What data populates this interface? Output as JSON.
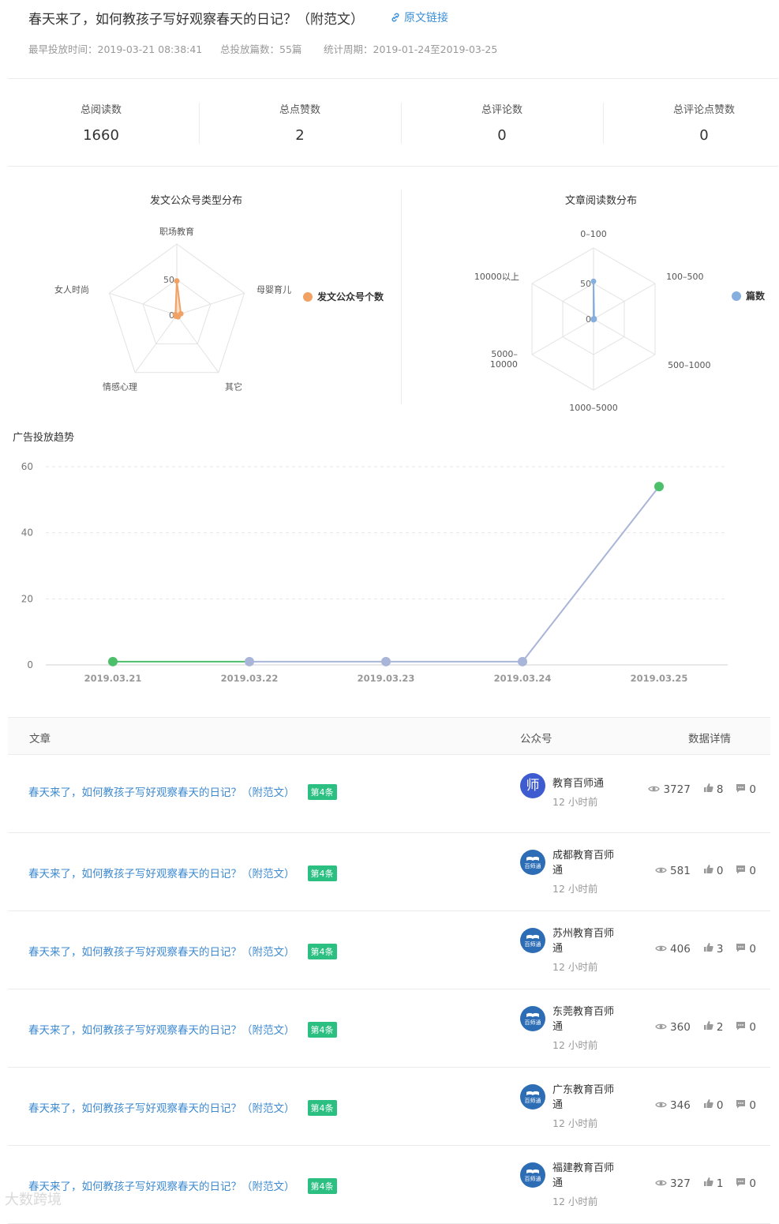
{
  "header": {
    "title": "春天来了，如何教孩子写好观察春天的日记？（附范文）",
    "link_label": "原文链接",
    "meta": [
      "最早投放时间：2019-03-21 08:38:41",
      "总投放篇数：55篇",
      "统计周期：2019-01-24至2019-03-25"
    ]
  },
  "stats": [
    {
      "label": "总阅读数",
      "value": "1660"
    },
    {
      "label": "总点赞数",
      "value": "2"
    },
    {
      "label": "总评论数",
      "value": "0"
    },
    {
      "label": "总评论点赞数",
      "value": "0"
    }
  ],
  "radar1": {
    "title": "发文公众号类型分布",
    "axes": [
      "职场教育",
      "母婴育儿",
      "其它",
      "情感心理",
      "女人时尚"
    ],
    "ticks": [
      "50",
      "0"
    ],
    "series_name": "发文公众号个数",
    "values": [
      48,
      6,
      3,
      2,
      2
    ],
    "max": 100,
    "color": "#f0a264"
  },
  "radar2": {
    "title": "文章阅读数分布",
    "axes": [
      "0–100",
      "100–500",
      "500–1000",
      "1000–5000",
      "5000–\n10000",
      "10000以上"
    ],
    "ticks": [
      "50",
      "0"
    ],
    "series_name": "篇数",
    "values": [
      53,
      1,
      1,
      1,
      0,
      0
    ],
    "max": 100,
    "color": "#86aede"
  },
  "chart_data": {
    "type": "line",
    "title": "广告投放趋势",
    "x": [
      "2019.03.21",
      "2019.03.22",
      "2019.03.23",
      "2019.03.24",
      "2019.03.25"
    ],
    "values": [
      1,
      1,
      1,
      1,
      54
    ],
    "ylim": [
      0,
      60
    ],
    "yticks": [
      "0",
      "20",
      "40",
      "60"
    ],
    "line_color": "#a8b5d9",
    "highlight_color": "#4cbf6b",
    "grid": true
  },
  "table": {
    "headers": [
      "文章",
      "公众号",
      "数据详情"
    ],
    "rows": [
      {
        "article": "春天来了，如何教孩子写好观察春天的日记？（附范文）",
        "badge": "第4条",
        "account": "教育百师通",
        "time": "12 小时前",
        "views": "3727",
        "likes": "8",
        "comments": "0",
        "avatar": "师"
      },
      {
        "article": "春天来了，如何教孩子写好观察春天的日记？（附范文）",
        "badge": "第4条",
        "account": "成都教育百师通",
        "time": "12 小时前",
        "views": "581",
        "likes": "0",
        "comments": "0",
        "avatar": "百师通"
      },
      {
        "article": "春天来了，如何教孩子写好观察春天的日记？（附范文）",
        "badge": "第4条",
        "account": "苏州教育百师通",
        "time": "12 小时前",
        "views": "406",
        "likes": "3",
        "comments": "0",
        "avatar": "百师通"
      },
      {
        "article": "春天来了，如何教孩子写好观察春天的日记？（附范文）",
        "badge": "第4条",
        "account": "东莞教育百师通",
        "time": "12 小时前",
        "views": "360",
        "likes": "2",
        "comments": "0",
        "avatar": "百师通"
      },
      {
        "article": "春天来了，如何教孩子写好观察春天的日记？（附范文）",
        "badge": "第4条",
        "account": "广东教育百师通",
        "time": "12 小时前",
        "views": "346",
        "likes": "0",
        "comments": "0",
        "avatar": "百师通"
      },
      {
        "article": "春天来了，如何教孩子写好观察春天的日记？（附范文）",
        "badge": "第4条",
        "account": "福建教育百师通",
        "time": "12 小时前",
        "views": "327",
        "likes": "1",
        "comments": "0",
        "avatar": "百师通"
      }
    ]
  },
  "watermark": "大数跨境"
}
